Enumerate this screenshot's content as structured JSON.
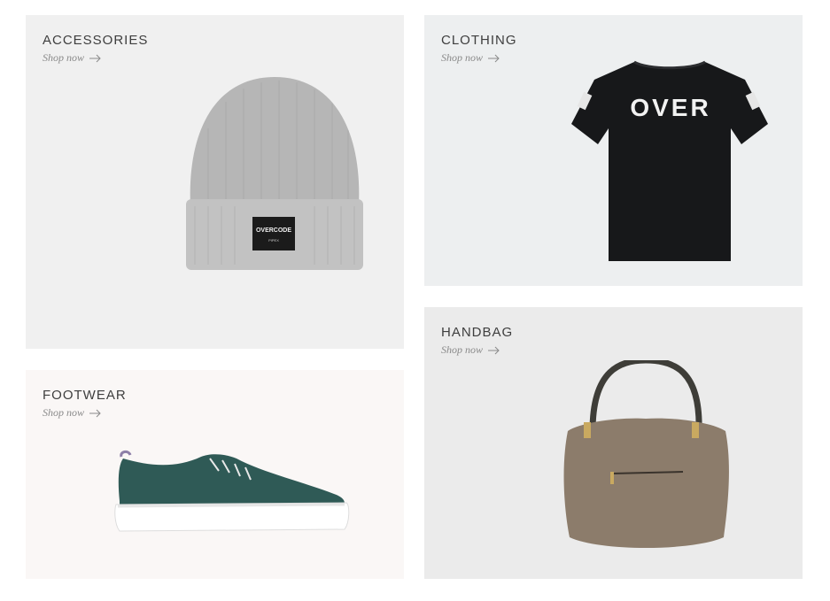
{
  "tiles": [
    {
      "title": "ACCESSORIES",
      "link": "Shop now",
      "product": "beanie"
    },
    {
      "title": "CLOTHING",
      "link": "Shop now",
      "product": "t-shirt"
    },
    {
      "title": "FOOTWEAR",
      "link": "Shop now",
      "product": "sneaker"
    },
    {
      "title": "HANDBAG",
      "link": "Shop now",
      "product": "handbag"
    }
  ],
  "art_text": {
    "beanie_label": "OVERCODE",
    "beanie_sub": "PIPEX",
    "tshirt_print": "OVER"
  },
  "colors": {
    "text": "#3e3e3e",
    "link": "#8a8a8a",
    "beanie": "#b9b9b9",
    "shirt": "#17181a",
    "sneaker": "#2f5a56",
    "bag": "#8c7c6b"
  }
}
